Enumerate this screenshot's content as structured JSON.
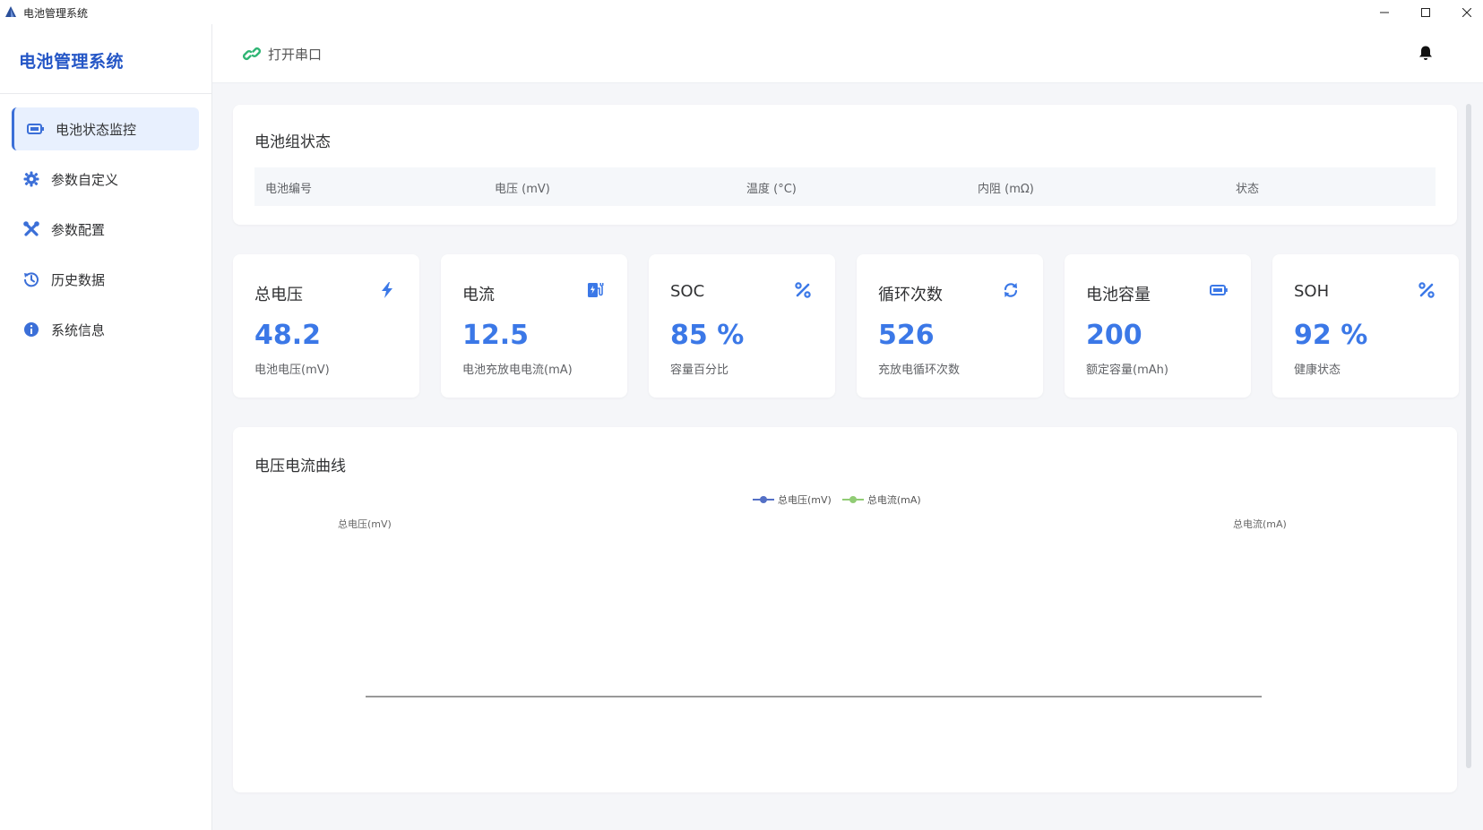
{
  "window": {
    "title": "电池管理系统"
  },
  "sidebar": {
    "brand": "电池管理系统",
    "items": [
      {
        "label": "电池状态监控",
        "icon": "battery-icon",
        "active": true
      },
      {
        "label": "参数自定义",
        "icon": "gear-icon",
        "active": false
      },
      {
        "label": "参数配置",
        "icon": "tools-icon",
        "active": false
      },
      {
        "label": "历史数据",
        "icon": "history-icon",
        "active": false
      },
      {
        "label": "系统信息",
        "icon": "info-icon",
        "active": false
      }
    ]
  },
  "header": {
    "serial_label": "打开串口",
    "serial_icon": "link-icon",
    "bell_icon": "bell-icon"
  },
  "battery_pack": {
    "title": "电池组状态",
    "columns": [
      "电池编号",
      "电压 (mV)",
      "温度 (°C)",
      "内阻 (mΩ)",
      "状态"
    ]
  },
  "metrics": [
    {
      "title": "总电压",
      "value": "48.2",
      "sub": "电池电压(mV)",
      "icon": "bolt-icon"
    },
    {
      "title": "电流",
      "value": "12.5",
      "sub": "电池充放电电流(mA)",
      "icon": "charging-station-icon"
    },
    {
      "title": "SOC",
      "value": "85 %",
      "sub": "容量百分比",
      "icon": "percent-icon"
    },
    {
      "title": "循环次数",
      "value": "526",
      "sub": "充放电循环次数",
      "icon": "refresh-icon"
    },
    {
      "title": "电池容量",
      "value": "200",
      "sub": "额定容量(mAh)",
      "icon": "battery-icon"
    },
    {
      "title": "SOH",
      "value": "92 %",
      "sub": "健康状态",
      "icon": "percent-icon"
    }
  ],
  "chart": {
    "title": "电压电流曲线"
  },
  "colors": {
    "accent": "#3b78e7",
    "brand": "#2456c6",
    "voltage": "#5470c6",
    "current": "#91cc75",
    "link": "#2fb574"
  },
  "chart_data": {
    "type": "line",
    "x": [],
    "series": [
      {
        "name": "总电压(mV)",
        "values": []
      },
      {
        "name": "总电流(mA)",
        "values": []
      }
    ],
    "ylabel_left": "总电压(mV)",
    "ylabel_right": "总电流(mA)",
    "legend": "top-center",
    "grid": false
  }
}
